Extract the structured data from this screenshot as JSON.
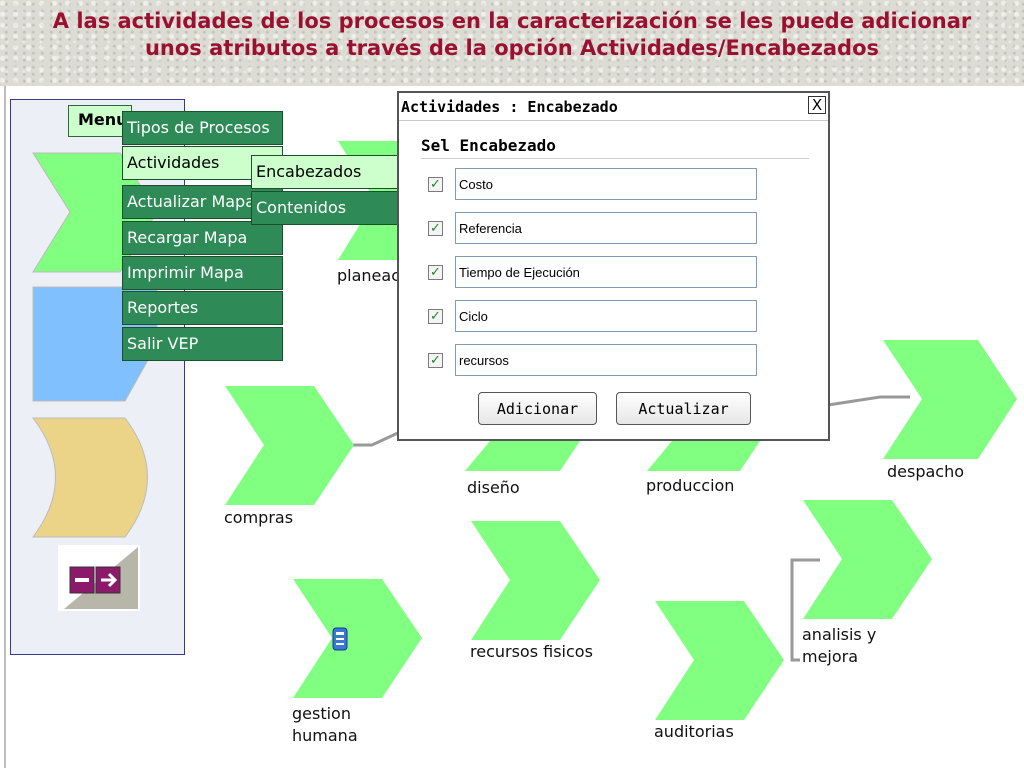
{
  "header": {
    "title_line1": "A las actividades de los procesos en la caracterización se les puede adicionar",
    "title_line2": "unos atributos a través de la opción Actividades/Encabezados"
  },
  "menu": {
    "title": "Menu",
    "items": [
      {
        "label": "Tipos de Procesos"
      },
      {
        "label": "Actividades"
      },
      {
        "label": "Actualizar Mapa"
      },
      {
        "label": "Recargar Mapa"
      },
      {
        "label": "Imprimir Mapa"
      },
      {
        "label": "Reportes"
      },
      {
        "label": "Salir VEP"
      }
    ],
    "submenu": [
      {
        "label": "Encabezados"
      },
      {
        "label": "Contenidos"
      }
    ]
  },
  "dialog": {
    "title": "Actividades : Encabezado",
    "close_label": "X",
    "section_label": "Sel Encabezado",
    "rows": [
      {
        "value": "Costo",
        "checked": true
      },
      {
        "value": "Referencia",
        "checked": true
      },
      {
        "value": "Tiempo de Ejecución",
        "checked": true
      },
      {
        "value": "Ciclo",
        "checked": true
      },
      {
        "value": "recursos",
        "checked": true
      }
    ],
    "check_glyph": "✓",
    "add_label": "Adicionar",
    "update_label": "Actualizar"
  },
  "map": {
    "planeacion_label": "planeac",
    "compras_label": "compras",
    "diseno_label": "diseño",
    "produccion_label": "produccion",
    "despacho_label": "despacho",
    "gestion_label_line1": "gestion",
    "gestion_label_line2": "humana",
    "recursos_label": "recursos fisicos",
    "auditorias_label": "auditorias",
    "analisis_label_line1": "analisis y",
    "analisis_label_line2": "mejora"
  },
  "colors": {
    "process_green": "#80ff80",
    "title_red": "#9b1030",
    "menu_dark": "#2e8b57",
    "menu_light": "#ccffcc",
    "palette_blue": "#80c0ff",
    "palette_tan": "#ebd487",
    "exit_purple": "#8b1a6b"
  }
}
